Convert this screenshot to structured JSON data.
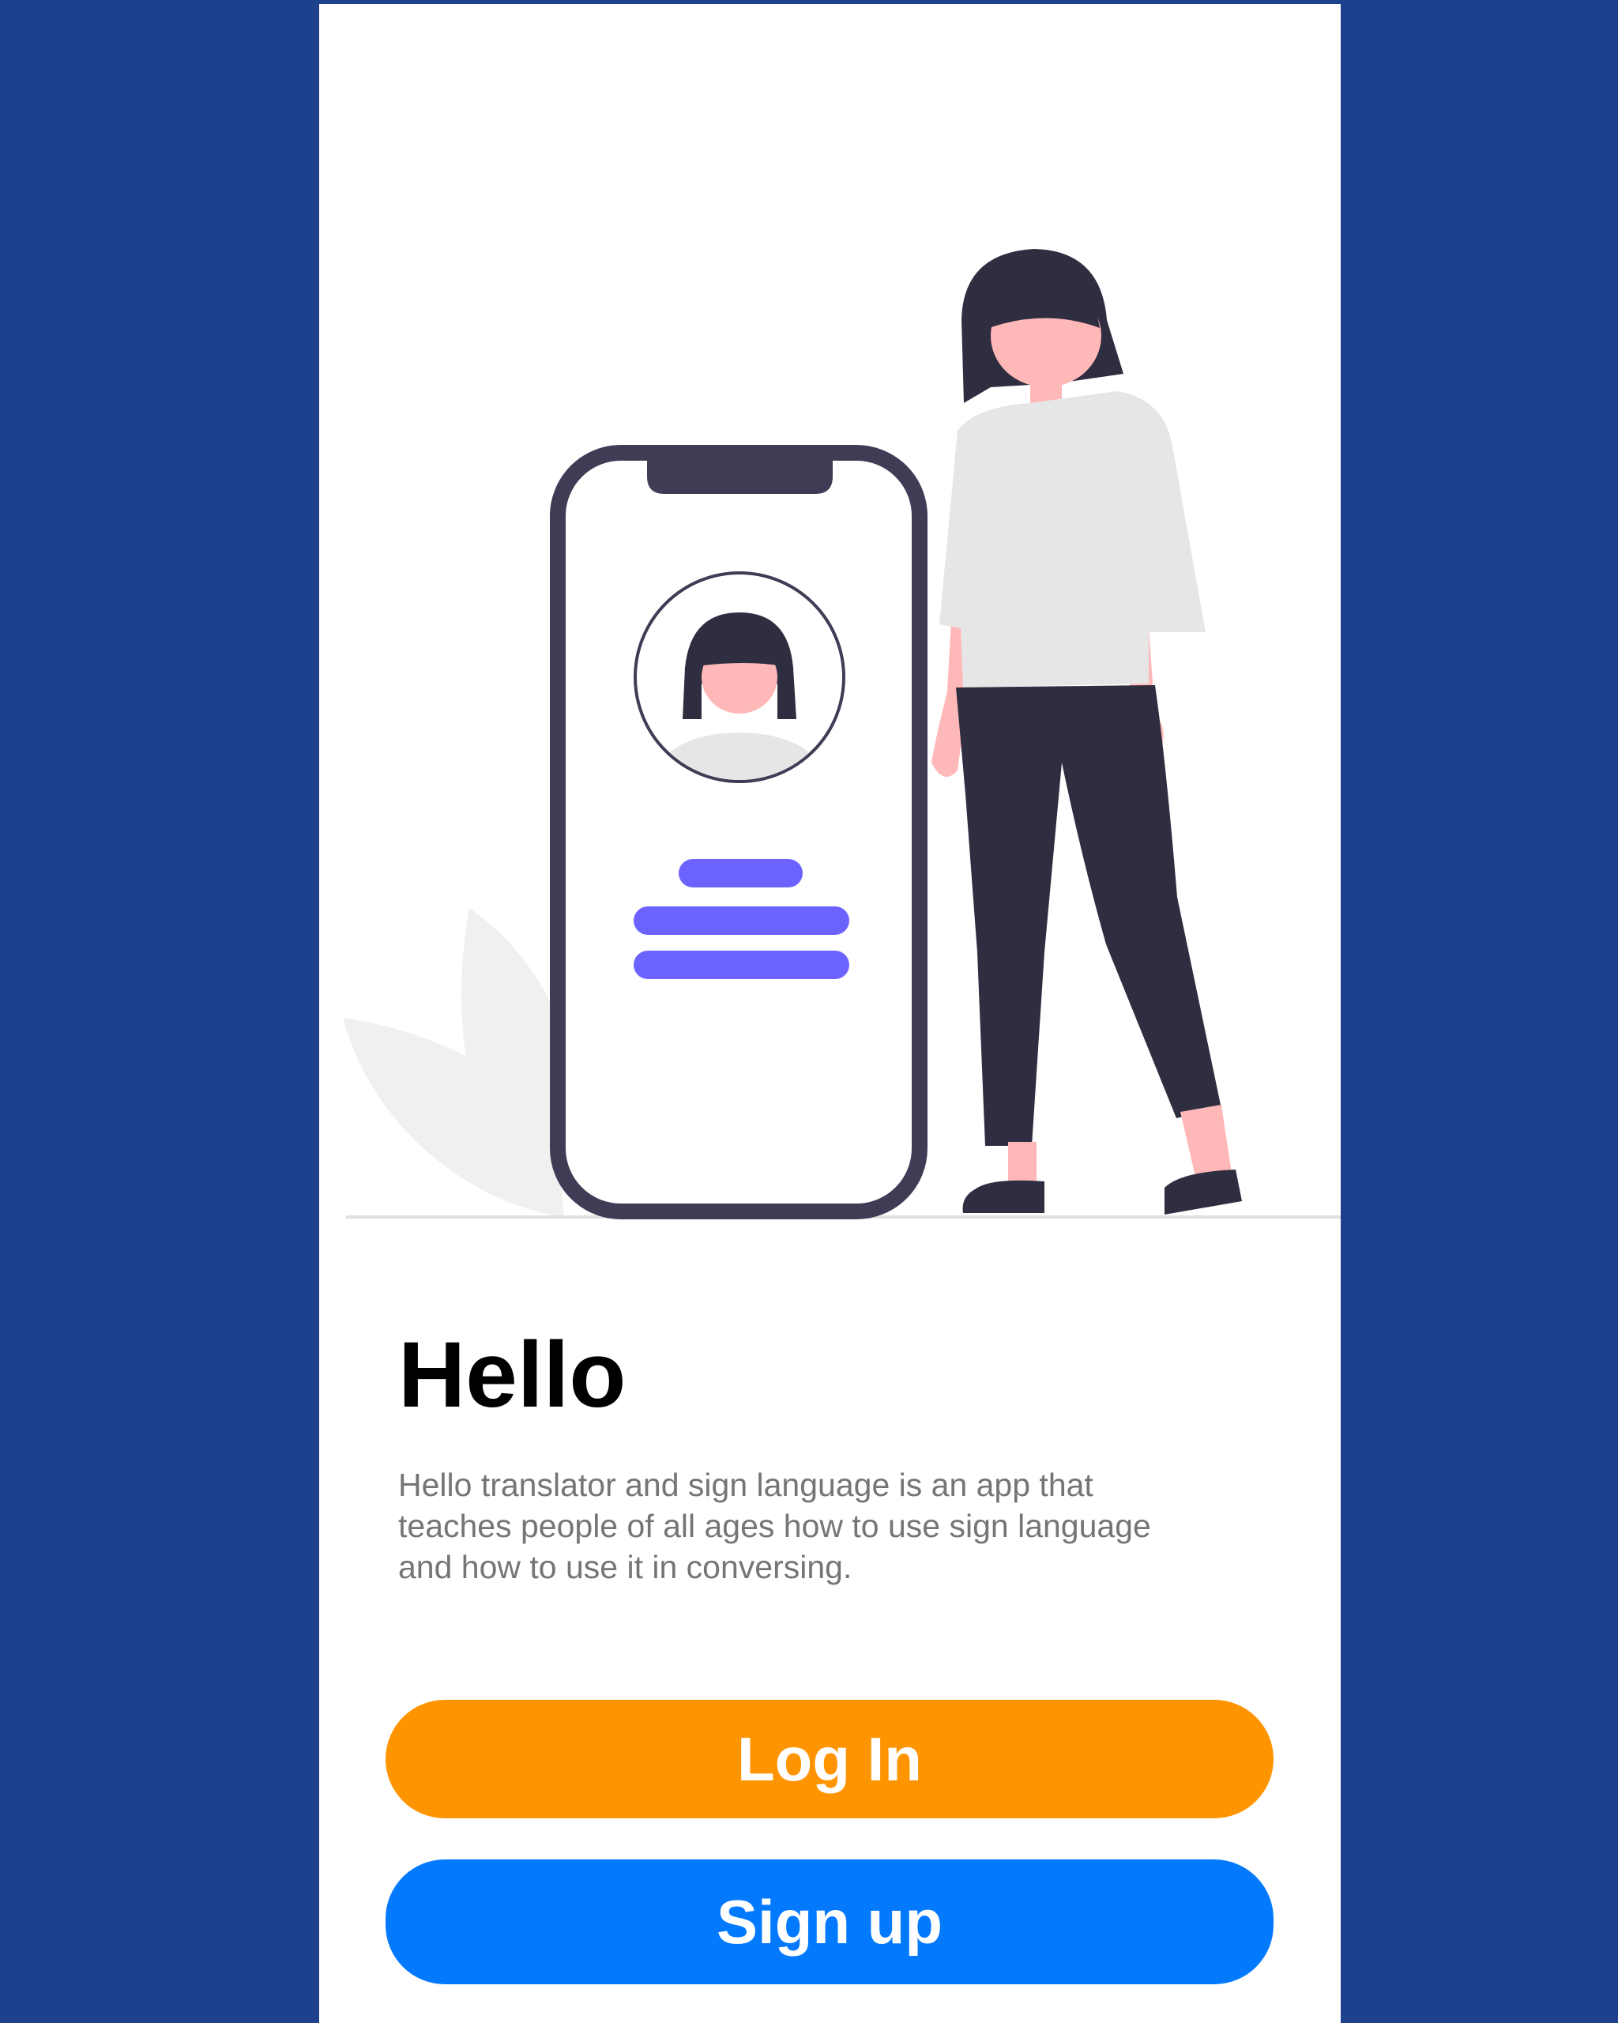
{
  "welcome": {
    "title": "Hello",
    "description": "Hello  translator and sign language is an app that\nteaches people of all ages how to use sign language\nand how to use it in conversing."
  },
  "buttons": {
    "login_label": "Log In",
    "signup_label": "Sign up"
  },
  "colors": {
    "page_background": "#1e418e",
    "screen_background": "#ffffff",
    "login_button": "#fe9500",
    "signup_button": "#037afe",
    "illustration_dark": "#2f2e41",
    "illustration_accent": "#6c63ff",
    "illustration_skin": "#ffb8b8",
    "illustration_shirt": "#e6e6e6"
  },
  "illustration": {
    "icons": [
      "plant-leaf-icon",
      "phone-icon",
      "profile-avatar-icon",
      "person-standing-icon"
    ]
  }
}
